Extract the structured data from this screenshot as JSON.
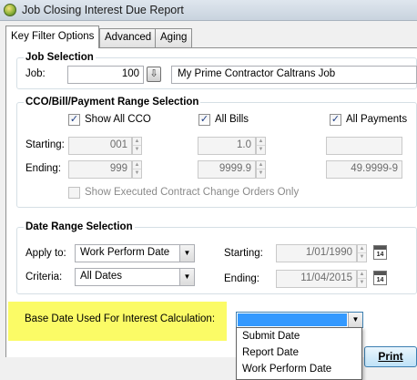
{
  "window": {
    "title": "Job Closing Interest Due Report"
  },
  "tabs": [
    {
      "label": "Key Filter Options"
    },
    {
      "label": "Advanced"
    },
    {
      "label": "Aging"
    }
  ],
  "job_selection": {
    "title": "Job Selection",
    "job_label": "Job:",
    "job_number": "100",
    "job_name": "My Prime Contractor Caltrans Job"
  },
  "range_selection": {
    "title": "CCO/Bill/Payment Range Selection",
    "show_all_cco": "Show All CCO",
    "all_bills": "All Bills",
    "all_payments": "All Payments",
    "starting_label": "Starting:",
    "ending_label": "Ending:",
    "cco_start": "001",
    "cco_end": "999",
    "bill_start": "1.0",
    "bill_end": "9999.9",
    "payment_start": "",
    "payment_end": "49.9999-9",
    "show_executed": "Show Executed Contract Change Orders Only"
  },
  "date_range": {
    "title": "Date Range Selection",
    "apply_to_label": "Apply to:",
    "apply_to_value": "Work Perform Date",
    "criteria_label": "Criteria:",
    "criteria_value": "All Dates",
    "starting_label": "Starting:",
    "starting_value": "1/01/1990",
    "ending_label": "Ending:",
    "ending_value": "11/04/2015",
    "calendar_day": "14"
  },
  "base_date": {
    "label": "Base Date Used For Interest Calculation:",
    "value": "",
    "options": [
      "Submit Date",
      "Report Date",
      "Work Perform Date"
    ]
  },
  "actions": {
    "print_label": "Print"
  },
  "colors": {
    "highlight": "#fbfb66",
    "check": "#1e3f86"
  }
}
